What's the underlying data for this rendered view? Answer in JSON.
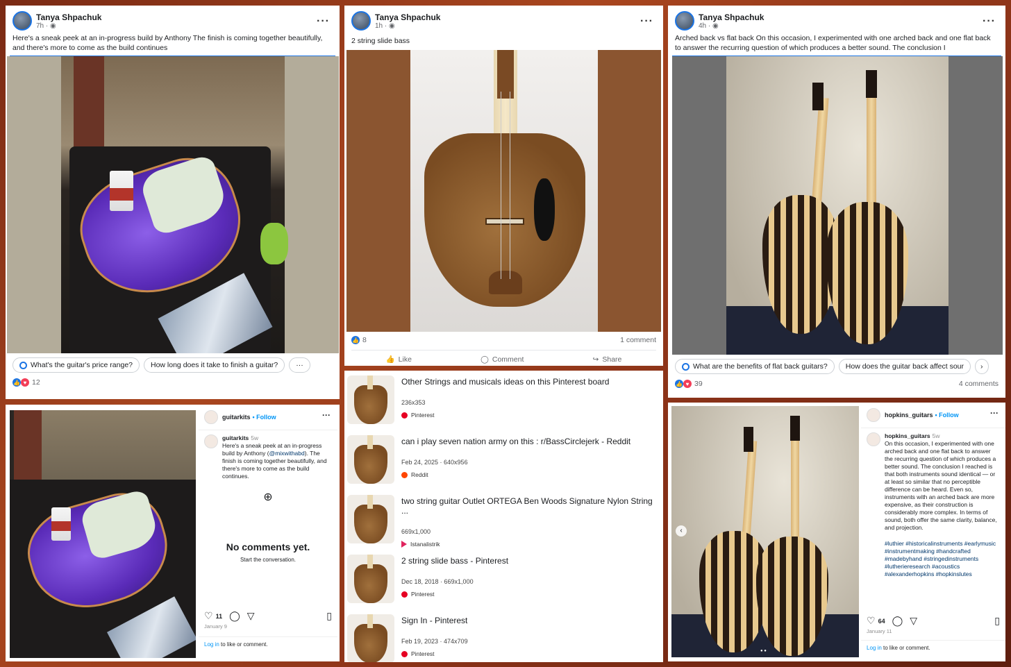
{
  "post1": {
    "author": "Tanya Shpachuk",
    "time": "7h · ◉",
    "text": "Here's a sneak peek at an in-progress build by Anthony The finish is coming together beautifully, and there's more to come as the build continues",
    "chip1": "What's the guitar's price range?",
    "chip2": "How long does it take to finish a guitar?",
    "reactions": "12"
  },
  "post2": {
    "author": "Tanya Shpachuk",
    "time": "1h · ◉",
    "text": "2 string slide bass",
    "reactions": "8",
    "comments": "1 comment",
    "like": "Like",
    "comment": "Comment",
    "share": "Share"
  },
  "post3": {
    "author": "Tanya Shpachuk",
    "time": "4h · ◉",
    "text": "Arched back vs flat back On this occasion, I experimented with one arched back and one flat back to answer the recurring question of which produces a better sound. The conclusion I",
    "chip1": "What are the benefits of flat back guitars?",
    "chip2": "How does the guitar back affect sour",
    "reactions": "39",
    "comments": "4 comments"
  },
  "pins": [
    {
      "title": "Other Strings and musicals ideas on this Pinterest board",
      "meta": "236x353",
      "source": "Pinterest"
    },
    {
      "title": "can i play seven nation army on this : r/BassCirclejerk - Reddit",
      "meta": "Feb 24, 2025 · 640x956",
      "source": "Reddit"
    },
    {
      "title": "two string guitar Outlet ORTEGA Ben Woods Signature Nylon String ...",
      "meta": "669x1,000",
      "source": "Istanalistrik"
    },
    {
      "title": "2 string slide bass - Pinterest",
      "meta": "Dec 18, 2018 · 669x1,000",
      "source": "Pinterest"
    },
    {
      "title": "Sign In - Pinterest",
      "meta": "Feb 19, 2023 · 474x709",
      "source": "Pinterest"
    }
  ],
  "ig1": {
    "user": "guitarkits",
    "follow": "Follow",
    "cap_user": "guitarkits",
    "cap_time": "5w",
    "caption_pre": "Here's a sneak peek at an in-progress build by Anthony (",
    "caption_mention": "@mixwithabd",
    "caption_post": "). The finish is coming together beautifully, and there's more to come as the build continues.",
    "no_comments": "No comments yet.",
    "start": "Start the conversation.",
    "likes": "11",
    "date": "January 9",
    "login_link": "Log in",
    "login_rest": " to like or comment."
  },
  "ig2": {
    "user": "hopkins_guitars",
    "follow": "Follow",
    "cap_user": "hopkins_guitars",
    "cap_time": "5w",
    "caption": "On this occasion, I experimented with one arched back and one flat back to answer the recurring question of which produces a better sound. The conclusion I reached is that both instruments sound identical — or at least so similar that no perceptible difference can be heard. Even so, instruments with an arched back are more expensive, as their construction is considerably more complex. In terms of sound, both offer the same clarity, balance, and projection.",
    "tags": "#luthier #historicalinstruments #earlymusic #instrumentmaking #handcrafted #madebyhand #stringedinstruments #lutherieresearch #acoustics #alexanderhopkins #hopkinslutes",
    "likes": "64",
    "date": "January 11",
    "login_link": "Log in",
    "login_rest": " to like or comment."
  }
}
